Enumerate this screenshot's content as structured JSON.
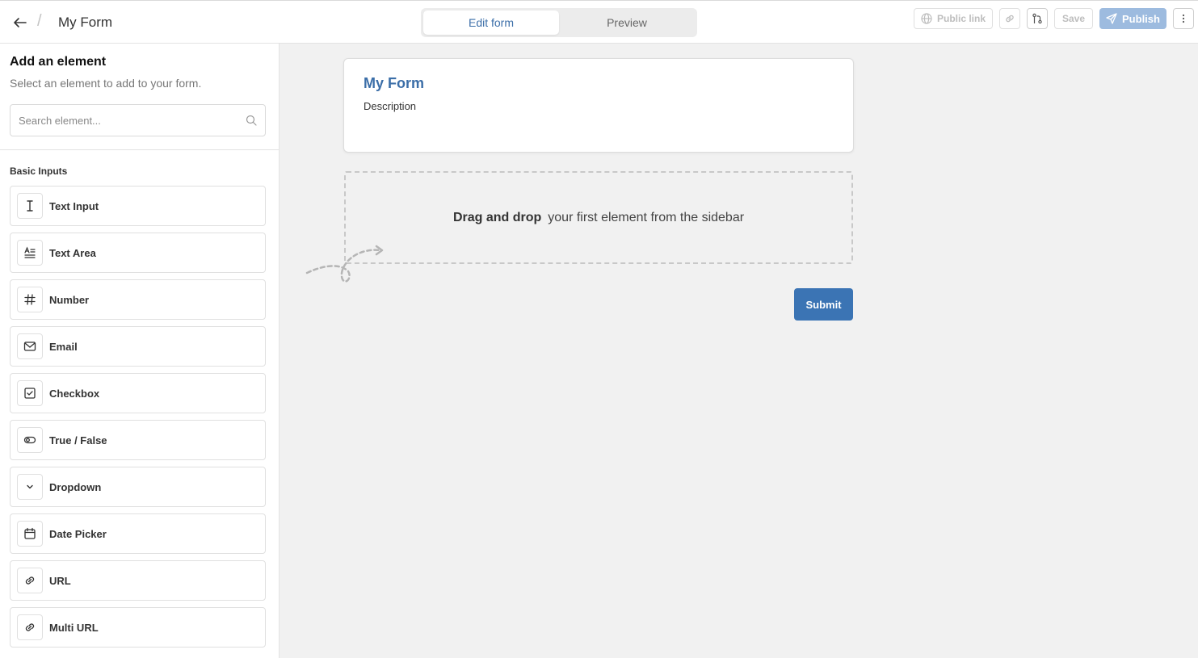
{
  "header": {
    "title": "My Form",
    "separator": "/",
    "tabs": [
      {
        "label": "Edit form",
        "active": true
      },
      {
        "label": "Preview",
        "active": false
      }
    ],
    "public_link_label": "Public link",
    "save_label": "Save",
    "publish_label": "Publish"
  },
  "sidebar": {
    "title": "Add an element",
    "subtitle": "Select an element to add to your form.",
    "search_placeholder": "Search element...",
    "section_title": "Basic Inputs",
    "items": [
      {
        "label": "Text Input",
        "icon": "text-cursor-icon"
      },
      {
        "label": "Text Area",
        "icon": "text-area-icon"
      },
      {
        "label": "Number",
        "icon": "hash-icon"
      },
      {
        "label": "Email",
        "icon": "mail-icon"
      },
      {
        "label": "Checkbox",
        "icon": "checkbox-icon"
      },
      {
        "label": "True / False",
        "icon": "toggle-icon"
      },
      {
        "label": "Dropdown",
        "icon": "chevron-down-icon"
      },
      {
        "label": "Date Picker",
        "icon": "calendar-icon"
      },
      {
        "label": "URL",
        "icon": "link-icon"
      },
      {
        "label": "Multi URL",
        "icon": "link-icon"
      }
    ]
  },
  "form": {
    "title": "My Form",
    "description": "Description",
    "dropzone_bold": "Drag and drop",
    "dropzone_text": "your first element from the sidebar",
    "submit_label": "Submit"
  },
  "colors": {
    "accent": "#3b74b4",
    "title_blue": "#3b6ea8",
    "publish_disabled": "#9dbbdf"
  }
}
